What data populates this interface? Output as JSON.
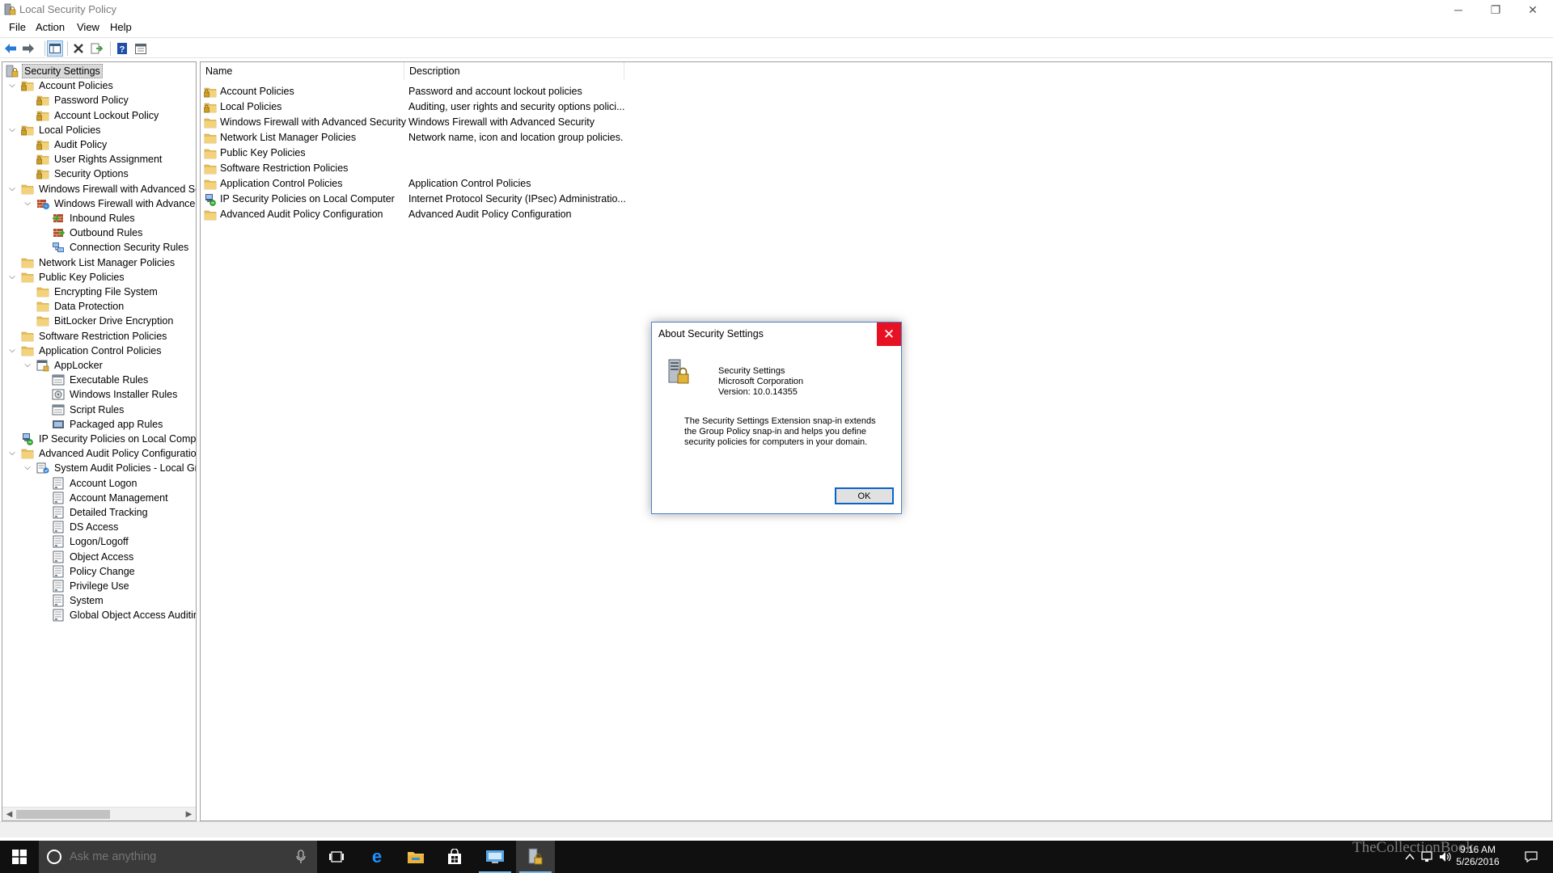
{
  "window": {
    "title": "Local Security Policy",
    "controls": {
      "minimize": "─",
      "restore": "❐",
      "close": "✕"
    }
  },
  "menu": [
    "File",
    "Action",
    "View",
    "Help"
  ],
  "toolbar": [
    "back-icon",
    "forward-icon",
    "show-hide-tree-icon",
    "delete-icon",
    "export-list-icon",
    "help-icon",
    "properties-icon"
  ],
  "tree": [
    {
      "label": "Security Settings",
      "level": 0,
      "icon": "security-settings-icon",
      "selected": true
    },
    {
      "label": "Account Policies",
      "level": 1,
      "expanded": true,
      "icon": "folder-lock-icon"
    },
    {
      "label": "Password Policy",
      "level": 2,
      "icon": "folder-lock-icon"
    },
    {
      "label": "Account Lockout Policy",
      "level": 2,
      "icon": "folder-lock-icon"
    },
    {
      "label": "Local Policies",
      "level": 1,
      "expanded": true,
      "icon": "folder-lock-icon"
    },
    {
      "label": "Audit Policy",
      "level": 2,
      "icon": "folder-lock-icon"
    },
    {
      "label": "User Rights Assignment",
      "level": 2,
      "icon": "folder-lock-icon"
    },
    {
      "label": "Security Options",
      "level": 2,
      "icon": "folder-lock-icon"
    },
    {
      "label": "Windows Firewall with Advanced Sec",
      "level": 1,
      "expanded": true,
      "icon": "folder-icon"
    },
    {
      "label": "Windows Firewall with Advanced",
      "level": 2,
      "expanded": true,
      "icon": "firewall-icon"
    },
    {
      "label": "Inbound Rules",
      "level": 3,
      "icon": "inbound-rules-icon"
    },
    {
      "label": "Outbound Rules",
      "level": 3,
      "icon": "outbound-rules-icon"
    },
    {
      "label": "Connection Security Rules",
      "level": 3,
      "icon": "connection-security-icon"
    },
    {
      "label": "Network List Manager Policies",
      "level": 1,
      "icon": "folder-icon"
    },
    {
      "label": "Public Key Policies",
      "level": 1,
      "expanded": true,
      "icon": "folder-icon"
    },
    {
      "label": "Encrypting File System",
      "level": 2,
      "icon": "folder-icon"
    },
    {
      "label": "Data Protection",
      "level": 2,
      "icon": "folder-icon"
    },
    {
      "label": "BitLocker Drive Encryption",
      "level": 2,
      "icon": "folder-icon"
    },
    {
      "label": "Software Restriction Policies",
      "level": 1,
      "icon": "folder-icon"
    },
    {
      "label": "Application Control Policies",
      "level": 1,
      "expanded": true,
      "icon": "folder-icon"
    },
    {
      "label": "AppLocker",
      "level": 2,
      "expanded": true,
      "icon": "applocker-icon"
    },
    {
      "label": "Executable Rules",
      "level": 3,
      "icon": "rules-icon"
    },
    {
      "label": "Windows Installer Rules",
      "level": 3,
      "icon": "installer-rules-icon"
    },
    {
      "label": "Script Rules",
      "level": 3,
      "icon": "rules-icon"
    },
    {
      "label": "Packaged app Rules",
      "level": 3,
      "icon": "packaged-app-rules-icon"
    },
    {
      "label": "IP Security Policies on Local Compute",
      "level": 1,
      "icon": "ip-security-icon"
    },
    {
      "label": "Advanced Audit Policy Configuration",
      "level": 1,
      "expanded": true,
      "icon": "folder-icon"
    },
    {
      "label": "System Audit Policies - Local Grou",
      "level": 2,
      "expanded": true,
      "icon": "audit-policies-icon"
    },
    {
      "label": "Account Logon",
      "level": 3,
      "icon": "audit-doc-icon"
    },
    {
      "label": "Account Management",
      "level": 3,
      "icon": "audit-doc-icon"
    },
    {
      "label": "Detailed Tracking",
      "level": 3,
      "icon": "audit-doc-icon"
    },
    {
      "label": "DS Access",
      "level": 3,
      "icon": "audit-doc-icon"
    },
    {
      "label": "Logon/Logoff",
      "level": 3,
      "icon": "audit-doc-icon"
    },
    {
      "label": "Object Access",
      "level": 3,
      "icon": "audit-doc-icon"
    },
    {
      "label": "Policy Change",
      "level": 3,
      "icon": "audit-doc-icon"
    },
    {
      "label": "Privilege Use",
      "level": 3,
      "icon": "audit-doc-icon"
    },
    {
      "label": "System",
      "level": 3,
      "icon": "audit-doc-icon"
    },
    {
      "label": "Global Object Access Auditing",
      "level": 3,
      "icon": "audit-doc-icon"
    }
  ],
  "list": {
    "columns": [
      "Name",
      "Description"
    ],
    "rows": [
      {
        "name": "Account Policies",
        "description": "Password and account lockout policies",
        "icon": "folder-lock-icon"
      },
      {
        "name": "Local Policies",
        "description": "Auditing, user rights and security options polici...",
        "icon": "folder-lock-icon"
      },
      {
        "name": "Windows Firewall with Advanced Security",
        "description": "Windows Firewall with Advanced Security",
        "icon": "folder-icon"
      },
      {
        "name": "Network List Manager Policies",
        "description": "Network name, icon and location group policies.",
        "icon": "folder-icon"
      },
      {
        "name": "Public Key Policies",
        "description": "",
        "icon": "folder-icon"
      },
      {
        "name": "Software Restriction Policies",
        "description": "",
        "icon": "folder-icon"
      },
      {
        "name": "Application Control Policies",
        "description": "Application Control Policies",
        "icon": "folder-icon"
      },
      {
        "name": "IP Security Policies on Local Computer",
        "description": "Internet Protocol Security (IPsec) Administratio...",
        "icon": "ip-security-icon"
      },
      {
        "name": "Advanced Audit Policy Configuration",
        "description": "Advanced Audit Policy Configuration",
        "icon": "folder-icon"
      }
    ]
  },
  "dialog": {
    "title": "About Security Settings",
    "close": "✕",
    "product": "Security Settings",
    "company": "Microsoft Corporation",
    "version": "Version: 10.0.14355",
    "description": "The Security Settings Extension snap-in extends the Group Policy snap-in and helps you define security policies for computers in your domain.",
    "ok_label": "OK"
  },
  "taskbar": {
    "search_placeholder": "Ask me anything",
    "apps": [
      "task-view-icon",
      "edge-icon",
      "file-explorer-icon",
      "store-icon",
      "remote-desktop-icon",
      "local-security-policy-icon"
    ],
    "time": "9:16 AM",
    "date": "5/26/2016",
    "watermark": "TheCollectionBook"
  },
  "colors": {
    "accent": "#0a64c8",
    "close_red": "#e81123",
    "taskbar": "#101010",
    "folder": "#e8c15d"
  }
}
